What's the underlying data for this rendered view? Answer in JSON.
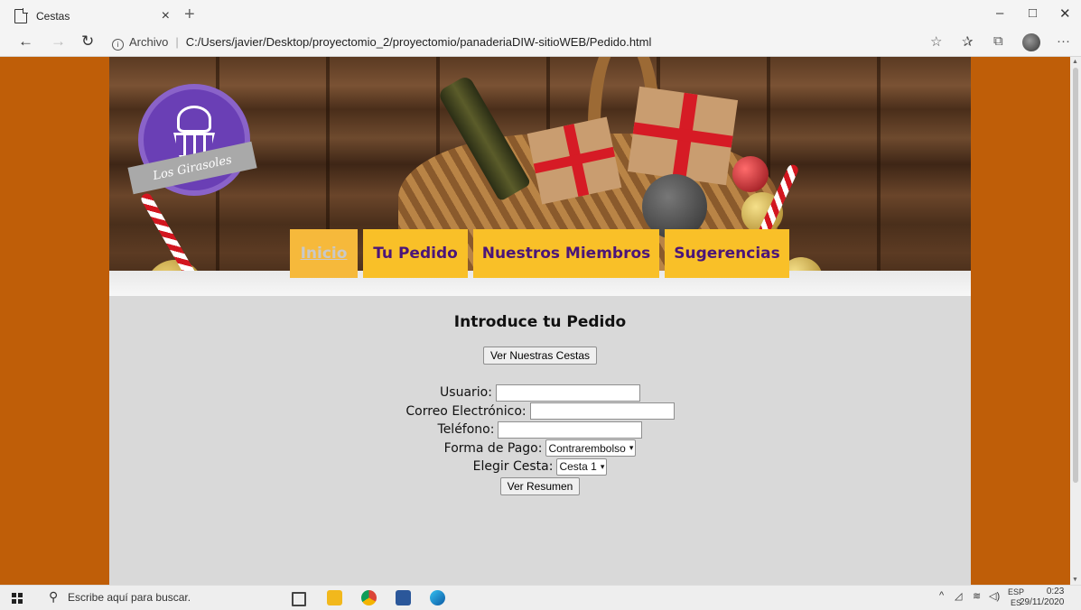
{
  "browser": {
    "tab_title": "Cestas",
    "tab_close": "×",
    "new_tab": "+",
    "url_prefix": "Archivo",
    "url_separator": "|",
    "url_path": "C:/Users/javier/Desktop/proyectomio_2/proyectomio/panaderiaDIW-sitioWEB/Pedido.html",
    "window_controls": {
      "minimize": "–",
      "maximize": "□",
      "close": "✕"
    },
    "tools": {
      "favorite": "☆",
      "favorites": "✰",
      "collections": "⧉",
      "more": "···"
    }
  },
  "site": {
    "logo_text": "Los Girasoles",
    "nav": [
      {
        "label": "Inicio",
        "current": true
      },
      {
        "label": "Tu Pedido",
        "current": false
      },
      {
        "label": "Nuestros Miembros",
        "current": false
      },
      {
        "label": "Sugerencias",
        "current": false
      }
    ]
  },
  "form": {
    "title": "Introduce tu Pedido",
    "view_baskets_button": "Ver Nuestras Cestas",
    "user_label": "Usuario:",
    "user_value": "",
    "email_label": "Correo Electrónico:",
    "email_value": "",
    "phone_label": "Teléfono:",
    "phone_value": "",
    "payment_label": "Forma de Pago:",
    "payment_selected": "Contrarembolso",
    "basket_label": "Elegir Cesta:",
    "basket_selected": "Cesta 1",
    "summary_button": "Ver Resumen"
  },
  "taskbar": {
    "search_placeholder": "Escribe aquí para buscar.",
    "lang_top": "ESP",
    "lang_bottom": "ES",
    "time": "0:23",
    "date": "29/11/2020"
  },
  "colors": {
    "side_background": "#bf5e08",
    "page_background": "#d9d9d9",
    "nav_background": "#f9c028",
    "nav_text": "#4b1579",
    "logo_purple": "#6a3fb5"
  }
}
